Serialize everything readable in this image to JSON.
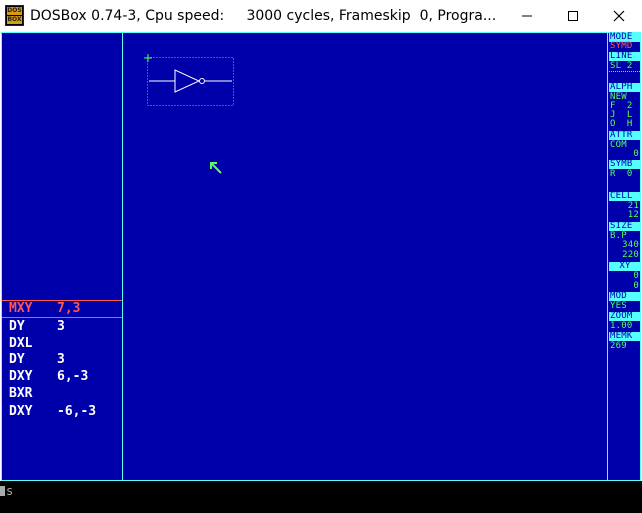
{
  "window": {
    "title": "DOSBox 0.74-3, Cpu speed:     3000 cycles, Frameskip  0, Progra...",
    "icon_top": "DOS",
    "icon_bottom": "BOX",
    "minimize_icon": "minimize-icon",
    "maximize_icon": "maximize-icon",
    "close_icon": "close-icon"
  },
  "colors": {
    "background": "#0000aa",
    "border": "#55ffff",
    "highlight": "#ff5555",
    "accent": "#55ff55",
    "text": "#ffffff"
  },
  "command_list": [
    {
      "cmd": "MXY",
      "args": "7,3",
      "selected": true
    },
    {
      "cmd": "DY",
      "args": "3",
      "selected": false
    },
    {
      "cmd": "DXL",
      "args": "",
      "selected": false
    },
    {
      "cmd": "DY",
      "args": "3",
      "selected": false
    },
    {
      "cmd": "DXY",
      "args": "6,-3",
      "selected": false
    },
    {
      "cmd": "BXR",
      "args": "",
      "selected": false
    },
    {
      "cmd": "DXY",
      "args": "-6,-3",
      "selected": false
    }
  ],
  "right_menu": {
    "mode_label": "MODE",
    "mode_value": "SYMD",
    "line_label": "LINE",
    "line_value": "SL 2",
    "alph_label": "ALPH",
    "alph_new": "NEW",
    "alph_row1": "F  2",
    "alph_row2": "J  L",
    "alph_row3": "O  H",
    "attr_label": "ATTR",
    "attr_com": "COM",
    "attr_value": "0",
    "symb_label": "SYMB",
    "symb_value": "R  0",
    "cell_label": "CELL",
    "cell_x": "21",
    "cell_y": "12",
    "size_label": "SIZE",
    "size_bp": "B.P",
    "size_w": "340",
    "size_h": "220",
    "xy_label": "XY",
    "xy_x": "0",
    "xy_y": "0",
    "mod_label": "MOD",
    "mod_value": "YES",
    "zoom_label": "ZOOM",
    "zoom_value": "1.00",
    "memk_label": "MEMK",
    "memk_value": "269"
  },
  "canvas": {
    "symbol": "inverter-gate",
    "origin_marker": "+",
    "pointer": "green-arrow-cursor"
  },
  "dos_prompt": {
    "text": "s"
  }
}
